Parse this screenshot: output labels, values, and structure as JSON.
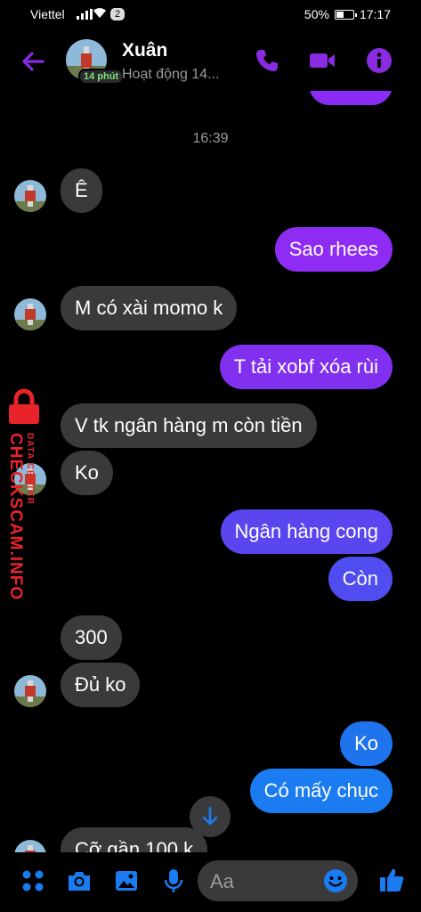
{
  "status_bar": {
    "carrier": "Viettel",
    "notifications": "2",
    "battery": "50%",
    "battery_level": 0.5,
    "time": "17:17"
  },
  "header": {
    "name": "Xuân",
    "active_badge": "14 phút",
    "status": "Hoạt động 14..."
  },
  "chat": {
    "timestamp": "16:39",
    "messages": [
      {
        "from": "them",
        "text": "Ê"
      },
      {
        "from": "me",
        "text": "Sao rhees"
      },
      {
        "from": "them",
        "text": "M có xài momo k"
      },
      {
        "from": "me",
        "text": "T tải xobf xóa rùi"
      },
      {
        "from": "them",
        "text": "V tk ngân hàng m còn tiền"
      },
      {
        "from": "them",
        "text": "Ko"
      },
      {
        "from": "me",
        "text": "Ngân hàng cong"
      },
      {
        "from": "me",
        "text": "Còn"
      },
      {
        "from": "them",
        "text": "300"
      },
      {
        "from": "them",
        "text": "Đủ ko"
      },
      {
        "from": "me",
        "text": "Ko"
      },
      {
        "from": "me",
        "text": "Có mấy chục"
      },
      {
        "from": "them",
        "text": "Cỡ gần 100 k"
      }
    ]
  },
  "watermark": {
    "brand": "CHECKSCAM.INFO",
    "tagline": "DATA CENTER"
  },
  "composer": {
    "placeholder": "Aa"
  },
  "colors": {
    "accent": "#8a2be2",
    "incoming": "#3a3a3c",
    "outgoing_top": "#8b2cf5",
    "outgoing_bottom": "#1a7cf0"
  }
}
